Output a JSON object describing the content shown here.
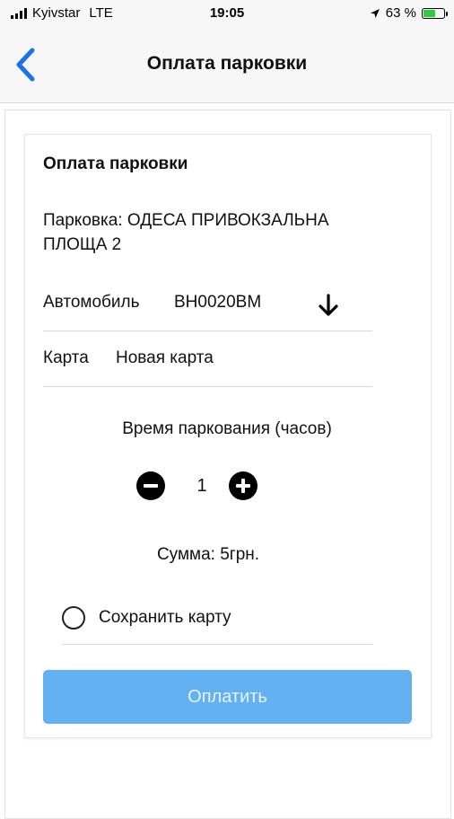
{
  "status_bar": {
    "carrier": "Kyivstar",
    "network": "LTE",
    "time": "19:05",
    "battery": "63 %",
    "battery_level": 0.63
  },
  "nav": {
    "title": "Оплата парковки",
    "back_icon": "chevron-left-icon",
    "accent_color": "#1a73e8"
  },
  "card": {
    "title": "Оплата парковки",
    "parking": "Парковка: ОДЕСА ПРИВОКЗАЛЬНА ПЛОЩА 2",
    "car_label": "Автомобиль",
    "car_value": "ВН0020ВМ",
    "car_dropdown_icon": "arrow-down-icon",
    "card_label": "Карта",
    "card_value": "Новая карта",
    "time_label": "Время паркования (часов)",
    "hours": "1",
    "decrement_icon": "minus-circle-icon",
    "increment_icon": "plus-circle-icon",
    "sum": "Сумма: 5грн.",
    "save_card_label": "Сохранить карту",
    "save_card_checked": false,
    "pay_button_label": "Оплатить",
    "pay_button_color": "#64b1f2"
  }
}
